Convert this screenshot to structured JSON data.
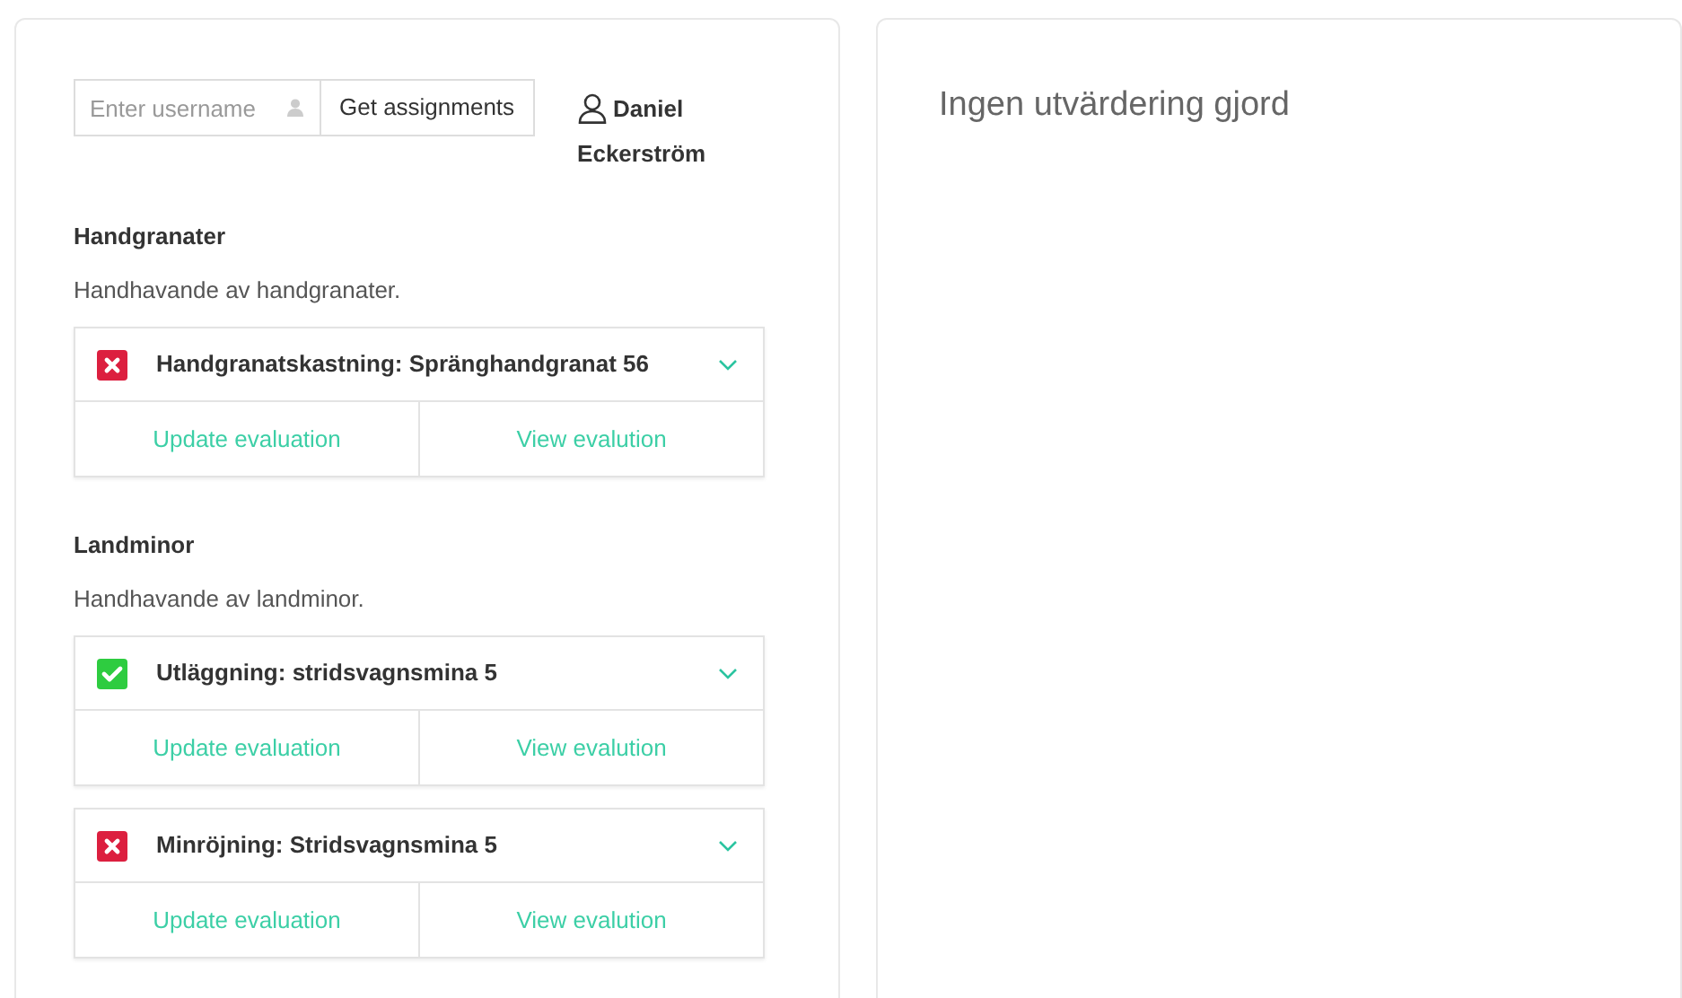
{
  "search": {
    "placeholder": "Enter username",
    "button": "Get assignments"
  },
  "user": {
    "first": "Daniel",
    "last": "Eckerström"
  },
  "groups": [
    {
      "title": "Handgranater",
      "description": "Handhavande av handgranater.",
      "assignments": [
        {
          "title": "Handgranatskastning: Spränghandgranat 56",
          "passed": false,
          "update": "Update evaluation",
          "view": "View evalution"
        }
      ]
    },
    {
      "title": "Landminor",
      "description": "Handhavande av landminor.",
      "assignments": [
        {
          "title": "Utläggning: stridsvagnsmina 5",
          "passed": true,
          "update": "Update evaluation",
          "view": "View evalution"
        },
        {
          "title": "Minröjning: Stridsvagnsmina 5",
          "passed": false,
          "update": "Update evaluation",
          "view": "View evalution"
        }
      ]
    }
  ],
  "evaluation": {
    "message": "Ingen utvärdering gjord"
  }
}
